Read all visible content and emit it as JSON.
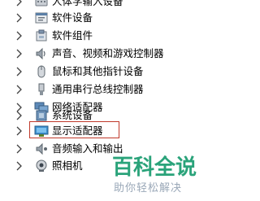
{
  "device_tree": {
    "items": [
      {
        "label": "人体学输入设备",
        "icon": "hid-icon"
      },
      {
        "label": "软件设备",
        "icon": "software-device-icon"
      },
      {
        "label": "软件组件",
        "icon": "software-component-icon"
      },
      {
        "label": "声音、视频和游戏控制器",
        "icon": "speaker-icon"
      },
      {
        "label": "鼠标和其他指针设备",
        "icon": "mouse-icon"
      },
      {
        "label": "通用串行总线控制器",
        "icon": "usb-icon"
      },
      {
        "label": "网络适配器",
        "icon": "network-adapter-icon"
      },
      {
        "label": "系统设备",
        "icon": "system-device-icon"
      },
      {
        "label": "显示适配器",
        "icon": "display-adapter-icon",
        "highlighted": true
      },
      {
        "label": "音频输入和输出",
        "icon": "audio-io-icon"
      },
      {
        "label": "照相机",
        "icon": "camera-icon"
      }
    ]
  },
  "highlight_color": "#c0392b",
  "watermark": {
    "logo_text": "百科全说",
    "subtitle": "助你轻松解决"
  }
}
